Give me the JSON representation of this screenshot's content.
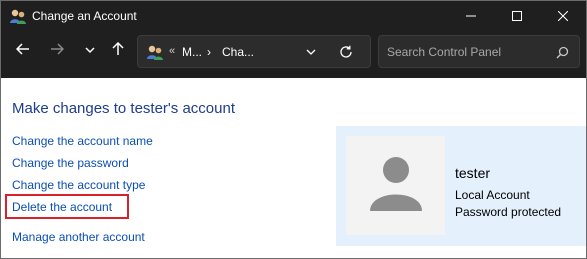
{
  "window": {
    "title": "Change an Account"
  },
  "address_bar": {
    "chevron": "«",
    "segment1": "M...",
    "separator": "›",
    "segment2": "Cha..."
  },
  "search": {
    "placeholder": "Search Control Panel"
  },
  "content": {
    "heading": "Make changes to tester's account",
    "links": [
      "Change the account name",
      "Change the password",
      "Change the account type",
      "Delete the account",
      "Manage another account"
    ]
  },
  "account": {
    "name": "tester",
    "type": "Local Account",
    "password_status": "Password protected"
  },
  "colors": {
    "titlebar_bg": "#1f1f1f",
    "link": "#0a4fb5",
    "heading": "#1e3d8f",
    "highlight": "#d7212b",
    "card_bg": "#e4f0fb"
  },
  "icons": {
    "app": "user-accounts-icon",
    "minimize": "minimize-icon",
    "maximize": "maximize-icon",
    "close": "close-icon",
    "back": "arrow-left-icon",
    "forward": "arrow-right-icon",
    "recent": "chevron-down-icon",
    "up": "arrow-up-icon",
    "refresh": "refresh-icon",
    "search": "search-icon",
    "avatar": "user-avatar-icon"
  }
}
